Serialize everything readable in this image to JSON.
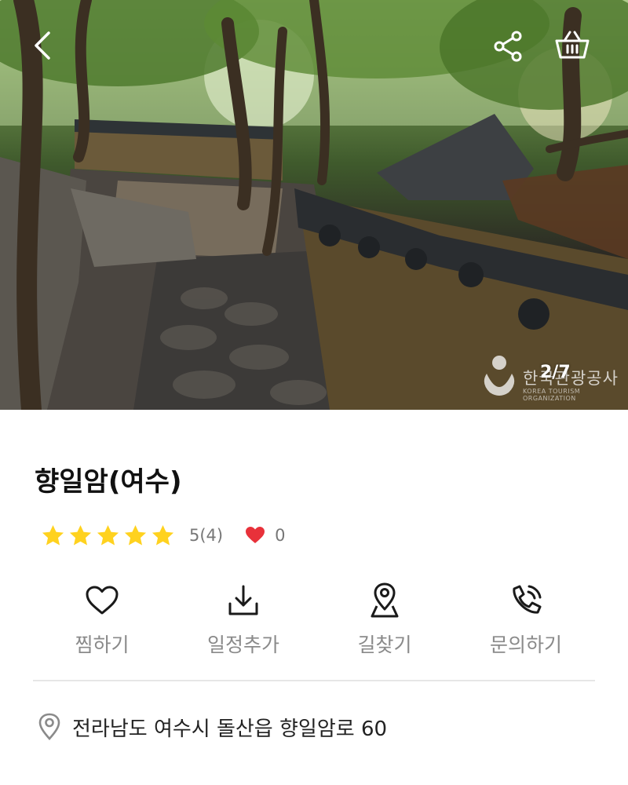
{
  "header": {
    "back_icon": "chevron-left-icon",
    "share_icon": "share-icon",
    "cart_icon": "basket-icon"
  },
  "gallery": {
    "counter": "2/7",
    "watermark_text": "한국관광공사",
    "watermark_sub": "KOREA TOURISM ORGANIZATION"
  },
  "place": {
    "title": "향일암(여수)",
    "rating": 5,
    "rating_text": "5(4)",
    "like_count": "0",
    "star_color": "#FFD21F",
    "heart_color": "#E8313A"
  },
  "actions": [
    {
      "icon": "heart-outline-icon",
      "label": "찜하기"
    },
    {
      "icon": "download-icon",
      "label": "일정추가"
    },
    {
      "icon": "map-pin-icon",
      "label": "길찾기"
    },
    {
      "icon": "phone-call-icon",
      "label": "문의하기"
    }
  ],
  "address": {
    "icon": "location-pin-icon",
    "text": "전라남도 여수시 돌산읍 향일암로 60"
  }
}
